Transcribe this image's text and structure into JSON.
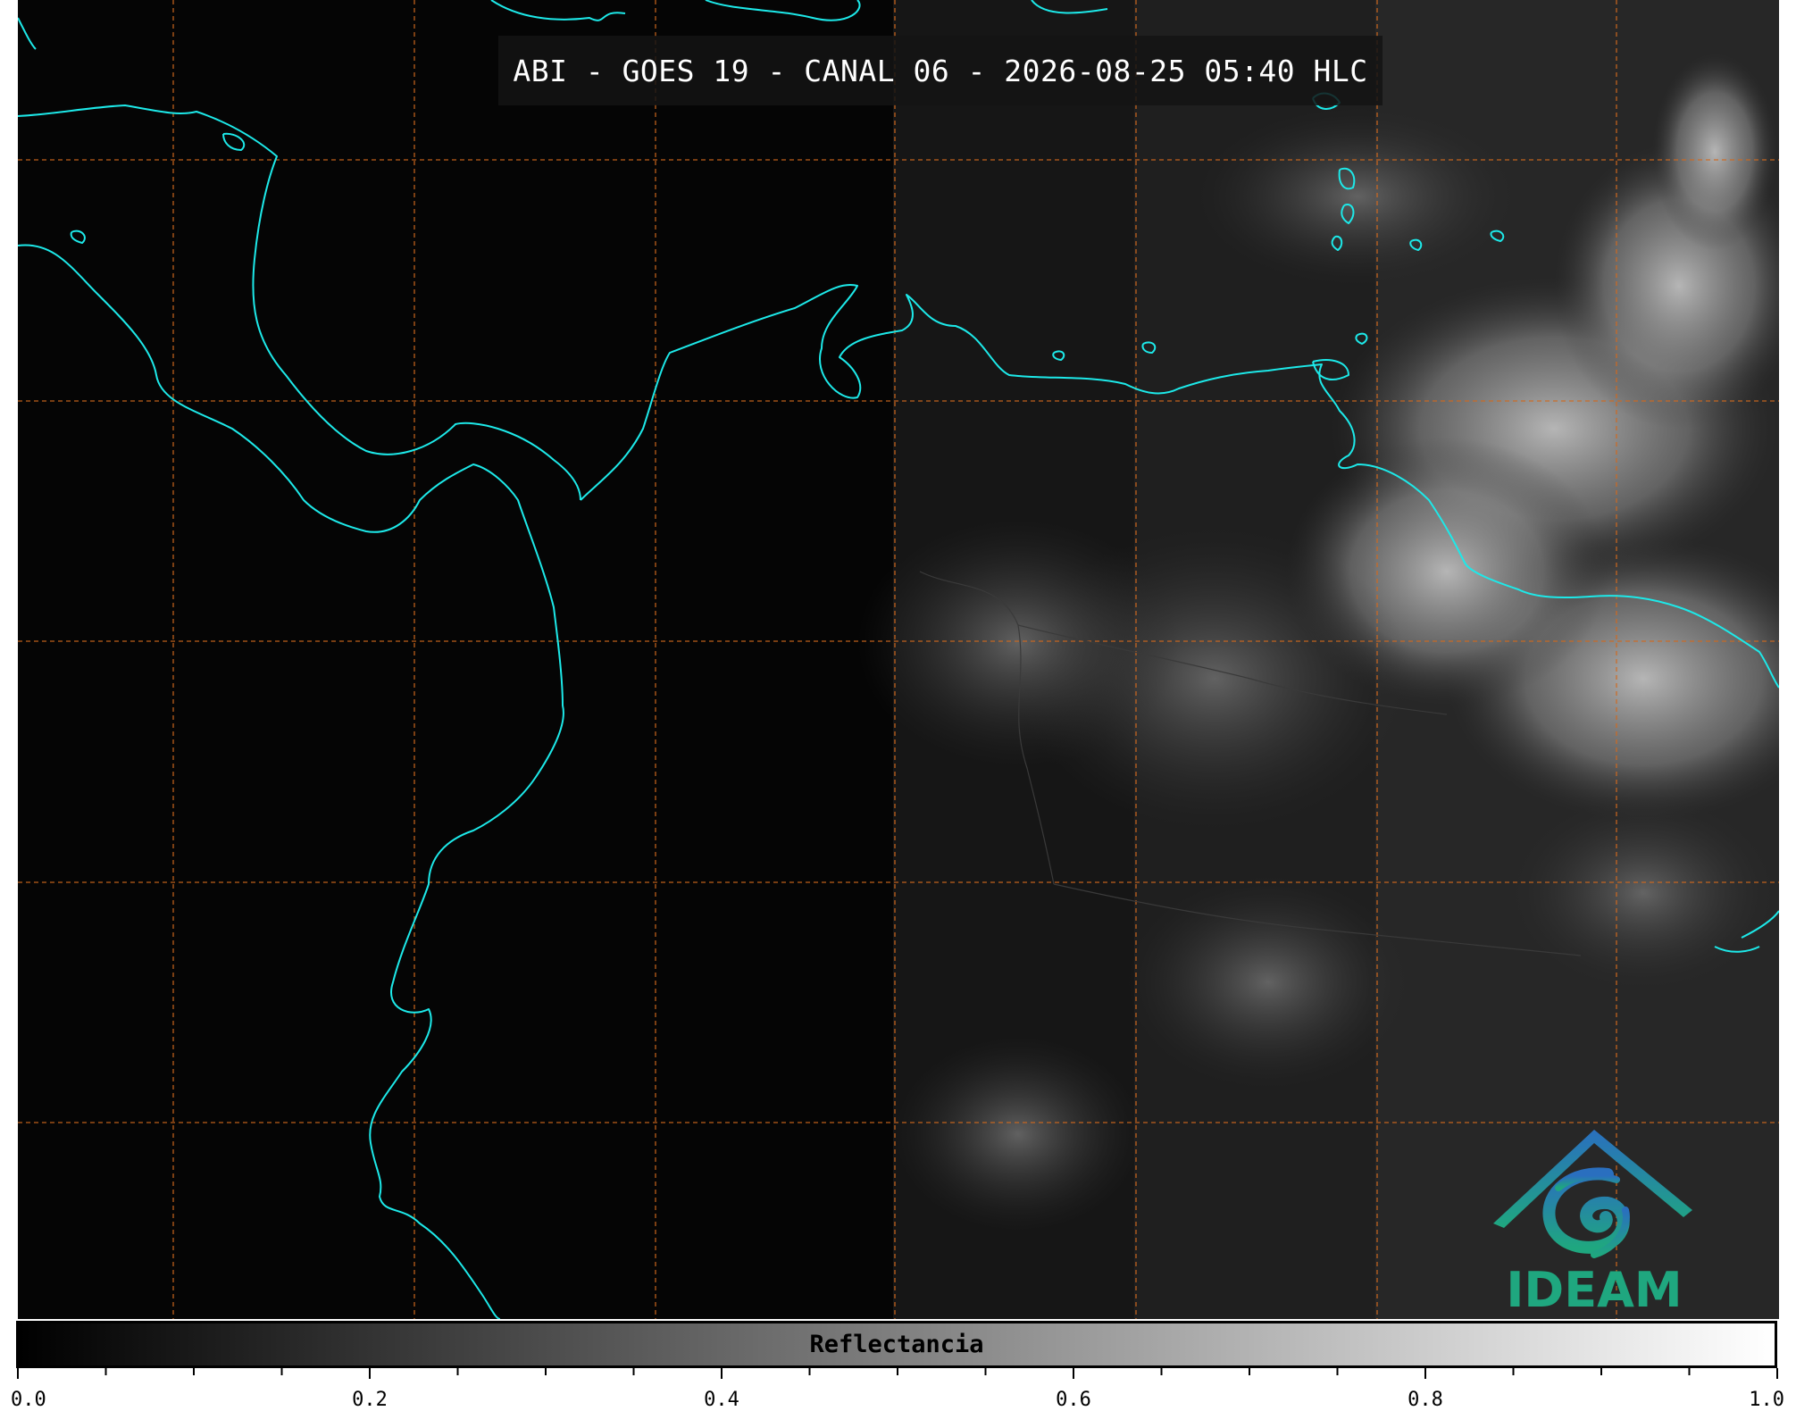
{
  "title": "ABI - GOES 19 - CANAL 06 - 2026-08-25 05:40 HLC",
  "colorbar": {
    "label": "Reflectancia",
    "min": 0.0,
    "max": 1.0,
    "tick_labels": [
      "0.0",
      "0.2",
      "0.4",
      "0.6",
      "0.8",
      "1.0"
    ],
    "colormap": [
      "#000000",
      "#ffffff"
    ]
  },
  "logo": {
    "text": "IDEAM"
  },
  "colors": {
    "coastline": "#1de9e9",
    "gridline": "#d2691e",
    "background": "#050505"
  }
}
